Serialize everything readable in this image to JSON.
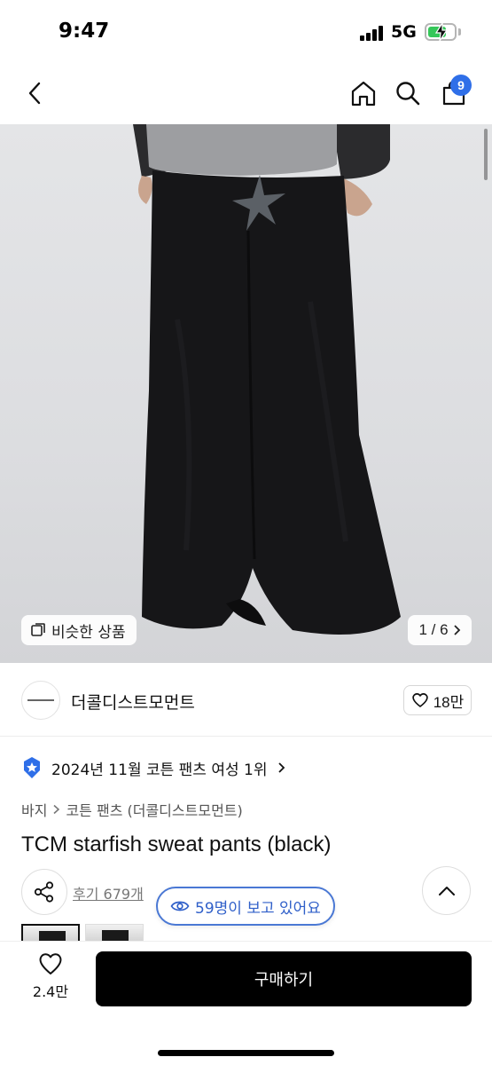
{
  "status_bar": {
    "time": "9:47",
    "network": "5G",
    "battery_level": 0.7
  },
  "nav": {
    "cart_count": "9"
  },
  "gallery": {
    "similar_label": "비슷한 상품",
    "page_indicator": "1 / 6"
  },
  "brand": {
    "name": "더콜디스트모먼트",
    "like_count": "18만"
  },
  "ranking": {
    "text": "2024년 11월 코튼 팬츠 여성 1위"
  },
  "breadcrumb": {
    "category": "바지",
    "subcategory": "코튼 팬츠 (더콜디스트모먼트)"
  },
  "product": {
    "title": "TCM starfish sweat pants (black)"
  },
  "reviews": {
    "label": "후기 679개"
  },
  "viewers": {
    "label": "59명이 보고 있어요"
  },
  "bottom_bar": {
    "wish_count": "2.4만",
    "buy_label": "구매하기"
  },
  "colors": {
    "accent_blue": "#2f6fe8",
    "buy_button": "#000000",
    "viewers_blue": "#4a78d4"
  }
}
